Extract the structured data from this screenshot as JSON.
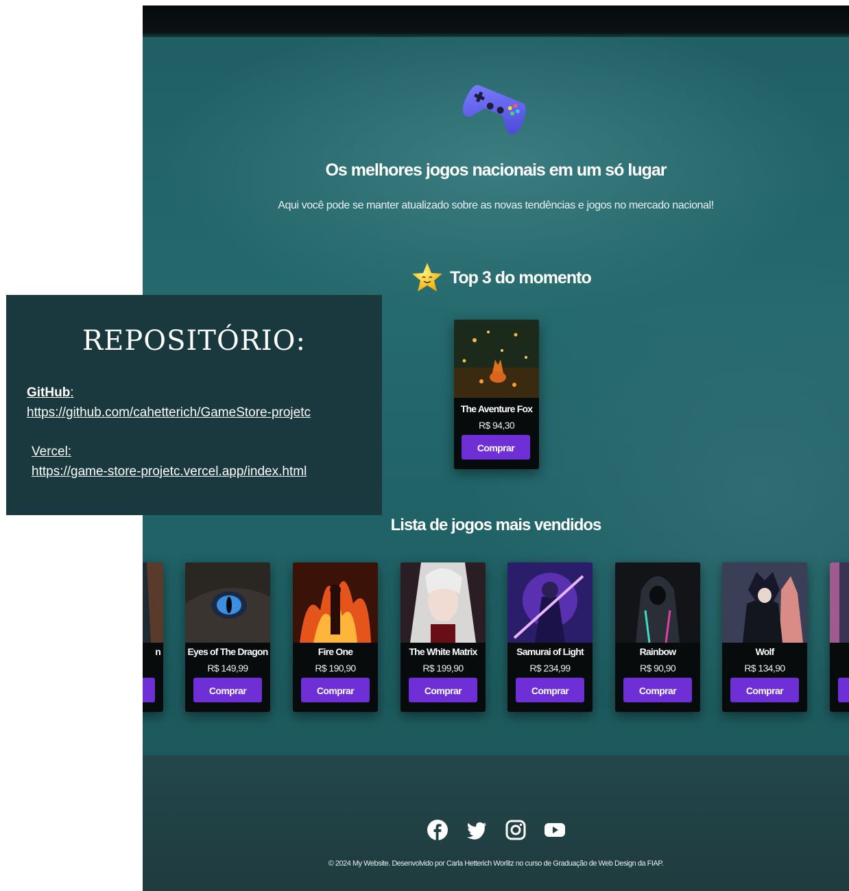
{
  "hero": {
    "title": "Os melhores jogos nacionais em um só lugar",
    "subtitle": "Aqui você pode se manter atualizado sobre as novas tendências e jogos no mercado nacional!",
    "icon": "gamepad-icon"
  },
  "top3": {
    "title": "Top 3 do momento",
    "icon": "star-icon",
    "featured": {
      "title": "The Aventure Fox",
      "price": "R$ 94,30",
      "buy": "Comprar"
    }
  },
  "bestsellers": {
    "title": "Lista de jogos mais vendidos",
    "items": [
      {
        "title": "n",
        "price": "",
        "buy": ""
      },
      {
        "title": "Eyes of The Dragon",
        "price": "R$ 149,99",
        "buy": "Comprar"
      },
      {
        "title": "Fire One",
        "price": "R$ 190,90",
        "buy": "Comprar"
      },
      {
        "title": "The White Matrix",
        "price": "R$ 199,90",
        "buy": "Comprar"
      },
      {
        "title": "Samurai of Light",
        "price": "R$ 234,99",
        "buy": "Comprar"
      },
      {
        "title": "Rainbow",
        "price": "R$ 90,90",
        "buy": "Comprar"
      },
      {
        "title": "Wolf",
        "price": "R$ 134,90",
        "buy": "Comprar"
      },
      {
        "title": "",
        "price": "",
        "buy": ""
      }
    ]
  },
  "footer": {
    "socials": [
      "facebook-icon",
      "twitter-icon",
      "instagram-icon",
      "youtube-icon"
    ],
    "copyright": "© 2024 My Website. Desenvolvido por Carla Hetterich Worlitz no curso de Graduação de Web Design da FIAP."
  },
  "repo": {
    "heading": "REPOSITÓRIO:",
    "github_label": "GitHub",
    "github_colon": ":",
    "github_url": "https://github.com/cahetterich/GameStore-projetc",
    "vercel_label": "Vercel:",
    "vercel_url": "https://game-store-projetc.vercel.app/index.html"
  },
  "colors": {
    "accent": "#6f2fd6",
    "panel": "#19393e",
    "background": "#1f5e63"
  }
}
